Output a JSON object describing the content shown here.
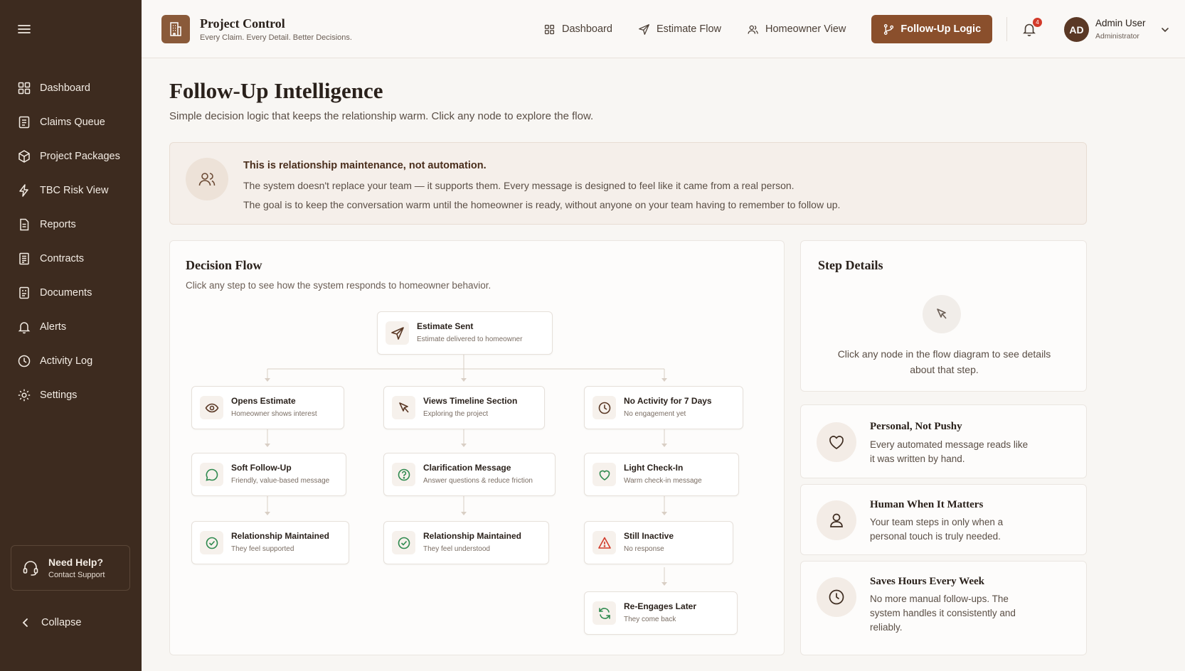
{
  "app": {
    "title": "Project Control",
    "tagline": "Every Claim. Every Detail. Better Decisions."
  },
  "sidebar": {
    "items": [
      {
        "label": "Dashboard",
        "icon": "grid-icon"
      },
      {
        "label": "Claims Queue",
        "icon": "clipboard-icon"
      },
      {
        "label": "Project Packages",
        "icon": "package-icon"
      },
      {
        "label": "TBC Risk View",
        "icon": "lightning-icon"
      },
      {
        "label": "Reports",
        "icon": "document-icon"
      },
      {
        "label": "Contracts",
        "icon": "contract-icon"
      },
      {
        "label": "Documents",
        "icon": "files-icon"
      },
      {
        "label": "Alerts",
        "icon": "bell-icon"
      },
      {
        "label": "Activity Log",
        "icon": "clock-icon"
      },
      {
        "label": "Settings",
        "icon": "gear-icon"
      }
    ],
    "help_title": "Need Help?",
    "help_sub": "Contact Support",
    "collapse_label": "Collapse"
  },
  "topnav": {
    "items": [
      "Dashboard",
      "Estimate Flow",
      "Homeowner View"
    ],
    "active": "Follow-Up Logic"
  },
  "header": {
    "notification_count": "4",
    "user_initials": "AD",
    "user_name": "Admin User",
    "user_role": "Administrator"
  },
  "page": {
    "title": "Follow-Up Intelligence",
    "subtitle": "Simple decision logic that keeps the relationship warm. Click any node to explore the flow."
  },
  "banner": {
    "heading": "This is relationship maintenance, not automation.",
    "line1": "The system doesn't replace your team — it supports them. Every message is designed to feel like it came from a real person.",
    "line2": "The goal is to keep the conversation warm until the homeowner is ready, without anyone on your team having to remember to follow up."
  },
  "flow": {
    "title": "Decision Flow",
    "subtitle": "Click any step to see how the system responds to homeowner behavior.",
    "root": {
      "title": "Estimate Sent",
      "sub": "Estimate delivered to homeowner"
    },
    "branches": [
      [
        {
          "title": "Opens Estimate",
          "sub": "Homeowner shows interest"
        },
        {
          "title": "Soft Follow-Up",
          "sub": "Friendly, value-based message"
        },
        {
          "title": "Relationship Maintained",
          "sub": "They feel supported"
        }
      ],
      [
        {
          "title": "Views Timeline Section",
          "sub": "Exploring the project"
        },
        {
          "title": "Clarification Message",
          "sub": "Answer questions & reduce friction"
        },
        {
          "title": "Relationship Maintained",
          "sub": "They feel understood"
        }
      ],
      [
        {
          "title": "No Activity for 7 Days",
          "sub": "No engagement yet"
        },
        {
          "title": "Light Check-In",
          "sub": "Warm check-in message"
        },
        {
          "title": "Still Inactive",
          "sub": "No response"
        },
        {
          "title": "Re-Engages Later",
          "sub": "They come back"
        }
      ]
    ]
  },
  "details": {
    "title": "Step Details",
    "empty_text": "Click any node in the flow diagram to see details about that step."
  },
  "features": [
    {
      "title": "Personal, Not Pushy",
      "text": "Every automated message reads like it was written by hand.",
      "icon": "heart-icon"
    },
    {
      "title": "Human When It Matters",
      "text": "Your team steps in only when a personal touch is truly needed.",
      "icon": "user-icon"
    },
    {
      "title": "Saves Hours Every Week",
      "text": "No more manual follow-ups. The system handles it consistently and reliably.",
      "icon": "clock-icon"
    }
  ],
  "colors": {
    "sidebar_bg": "#3d2b1f",
    "accent": "#8a4f2c",
    "success": "#2f8a4f",
    "danger": "#d23a2a"
  }
}
